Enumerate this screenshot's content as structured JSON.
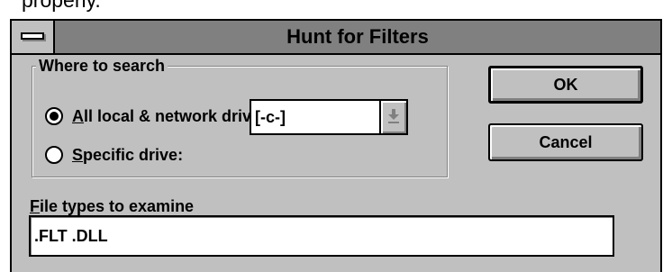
{
  "above_text": "properly.",
  "dialog": {
    "title": "Hunt for Filters"
  },
  "where_to_search": {
    "label": "Where to search",
    "options": [
      {
        "accel": "A",
        "rest": "ll local & network drives",
        "selected": true
      },
      {
        "accel": "S",
        "rest": "pecific drive:",
        "selected": false
      }
    ],
    "drive_select": {
      "value": "[-c-]",
      "enabled": false
    }
  },
  "buttons": {
    "ok_label": "OK",
    "cancel_label": "Cancel"
  },
  "file_types": {
    "label_accel": "F",
    "label_rest": "ile types to examine",
    "value": ".FLT .DLL"
  },
  "icons": {
    "system_menu": "system-menu-icon",
    "combo_arrow": "down-arrow-icon"
  }
}
